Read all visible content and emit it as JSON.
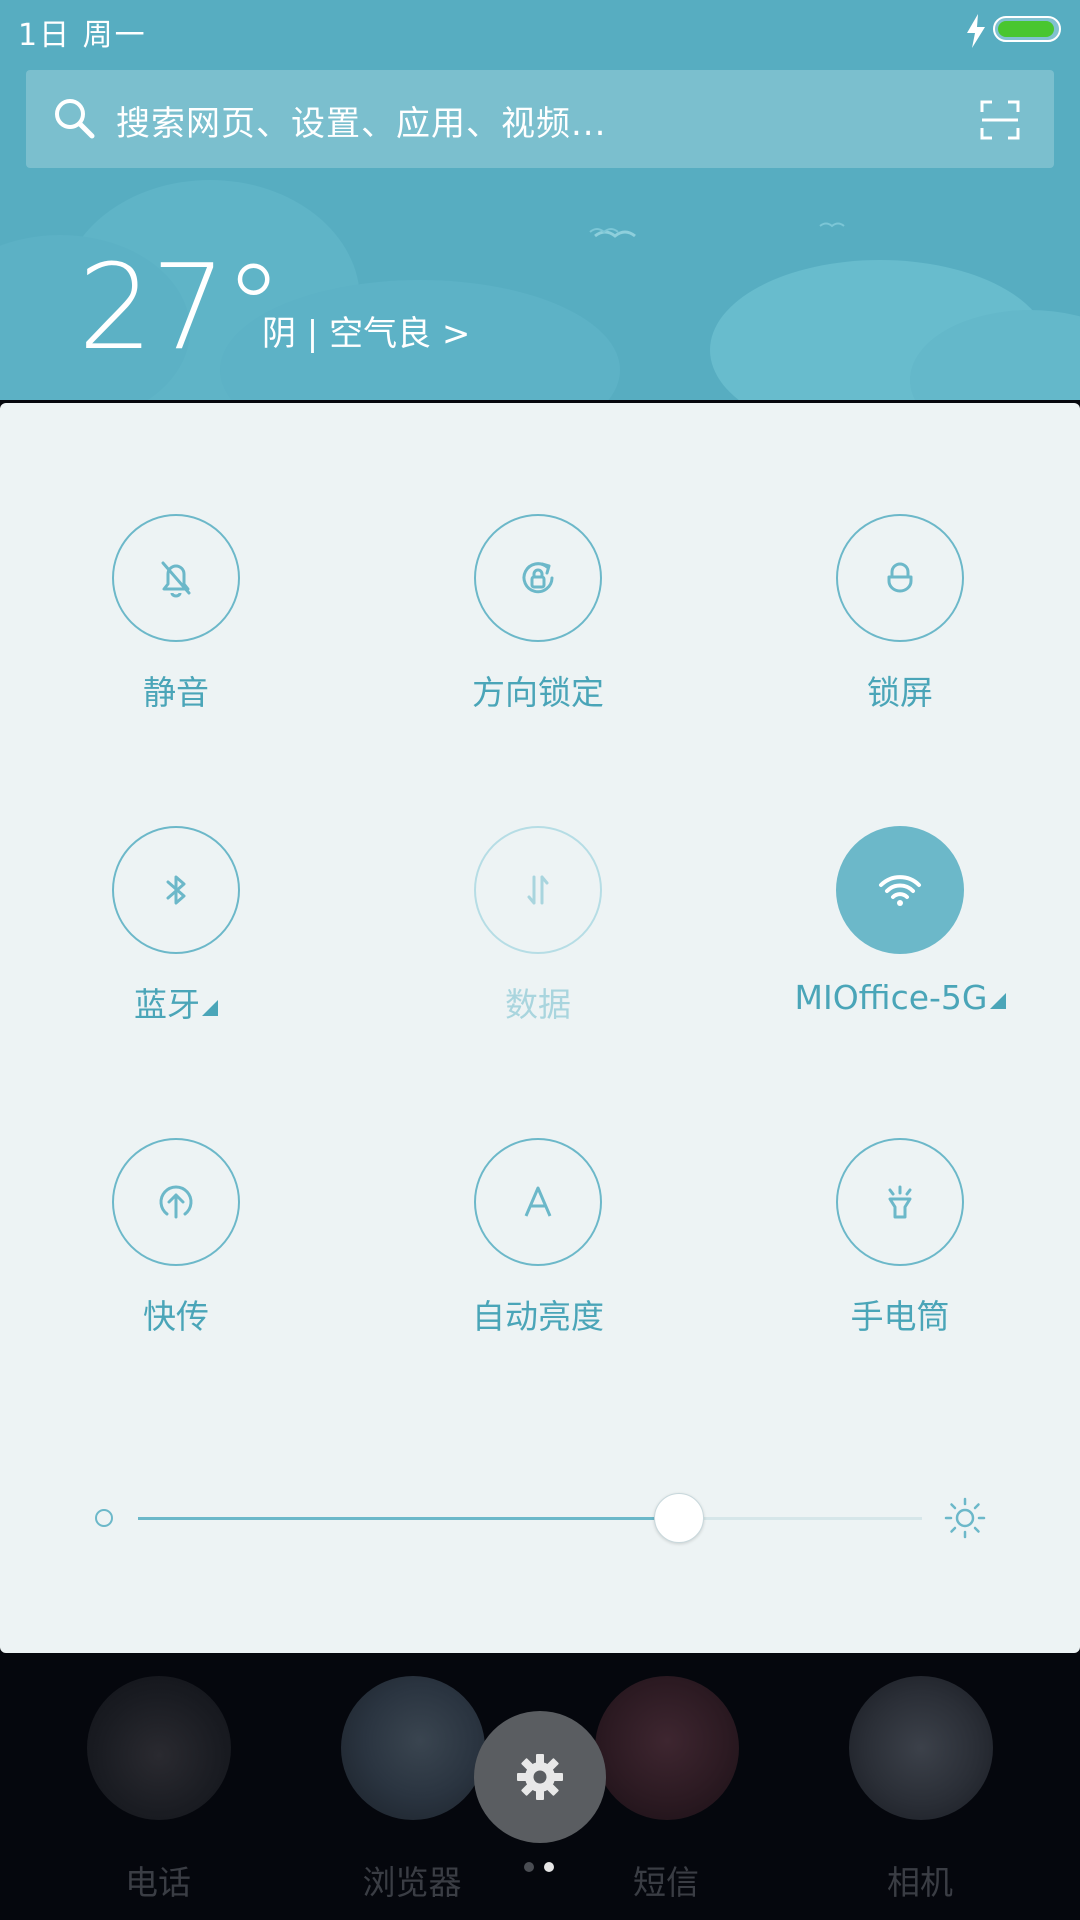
{
  "status_bar": {
    "date": "1日 周一"
  },
  "search": {
    "placeholder": "搜索网页、设置、应用、视频..."
  },
  "weather": {
    "temperature": "27°",
    "description": "阴 | 空气良 >"
  },
  "quick_settings": [
    {
      "label": "静音",
      "icon": "bell-off-icon",
      "state": "off"
    },
    {
      "label": "方向锁定",
      "icon": "rotation-lock-icon",
      "state": "off"
    },
    {
      "label": "锁屏",
      "icon": "lock-icon",
      "state": "off"
    },
    {
      "label": "蓝牙",
      "icon": "bluetooth-icon",
      "state": "off"
    },
    {
      "label": "数据",
      "icon": "data-arrows-icon",
      "state": "disabled"
    },
    {
      "label": "MIOffice-5G",
      "icon": "wifi-icon",
      "state": "on"
    },
    {
      "label": "快传",
      "icon": "upload-icon",
      "state": "off"
    },
    {
      "label": "自动亮度",
      "icon": "auto-brightness-icon",
      "state": "off"
    },
    {
      "label": "手电筒",
      "icon": "flashlight-icon",
      "state": "off"
    }
  ],
  "brightness": {
    "level": 0.69
  },
  "dock": [
    {
      "label": "电话"
    },
    {
      "label": "浏览器"
    },
    {
      "label": "短信"
    },
    {
      "label": "相机"
    }
  ],
  "colors": {
    "accent": "#6cb8c9",
    "header": "#57adc1",
    "panel": "#edf3f4",
    "battery": "#49c62f"
  }
}
